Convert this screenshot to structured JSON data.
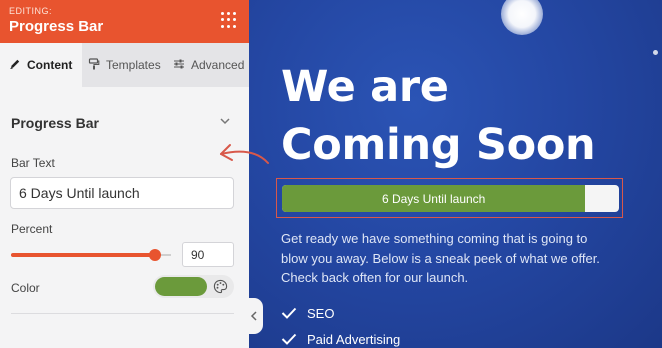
{
  "sidebar": {
    "editing_label": "EDITING:",
    "title": "Progress Bar",
    "tabs": [
      {
        "label": "Content",
        "icon": "pencil-icon",
        "active": true
      },
      {
        "label": "Templates",
        "icon": "paint-roller-icon",
        "active": false
      },
      {
        "label": "Advanced",
        "icon": "sliders-icon",
        "active": false
      }
    ],
    "section_title": "Progress Bar",
    "bar_text": {
      "label": "Bar Text",
      "value": "6 Days Until launch"
    },
    "percent": {
      "label": "Percent",
      "value": 90
    },
    "color": {
      "label": "Color",
      "value": "#6b9a3b"
    }
  },
  "preview": {
    "heading": "We are Coming Soon",
    "progress": {
      "text": "6 Days Until launch",
      "percent": 90,
      "color": "#6b9a3b"
    },
    "description": "Get ready we have something coming that is going to blow you away. Below is a sneak peek of what we offer. Check back often for our launch.",
    "features": [
      "SEO",
      "Paid Advertising"
    ]
  },
  "colors": {
    "accent": "#e8542f",
    "preview_bg": "#2447a3",
    "annotation": "#d8584a"
  }
}
